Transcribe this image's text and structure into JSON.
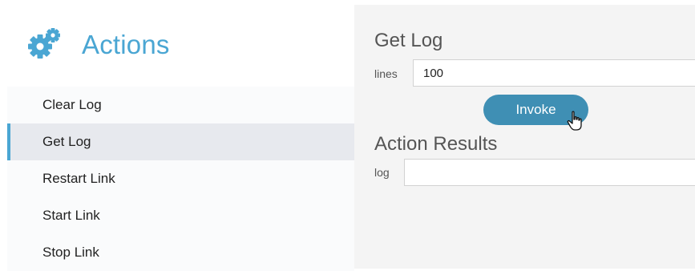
{
  "sidebar": {
    "title": "Actions",
    "icon": "gears-icon",
    "items": [
      {
        "label": "Clear Log",
        "active": false
      },
      {
        "label": "Get Log",
        "active": true
      },
      {
        "label": "Restart Link",
        "active": false
      },
      {
        "label": "Start Link",
        "active": false
      },
      {
        "label": "Stop Link",
        "active": false
      }
    ]
  },
  "main": {
    "form_title": "Get Log",
    "lines_label": "lines",
    "lines_value": "100",
    "invoke_label": "Invoke",
    "results_title": "Action Results",
    "log_label": "log",
    "log_value": ""
  },
  "colors": {
    "accent": "#4aa6d3",
    "button": "#3f8fb4",
    "active_item_bg": "#e7e9ee",
    "panel_bg": "#f4f4f4"
  }
}
